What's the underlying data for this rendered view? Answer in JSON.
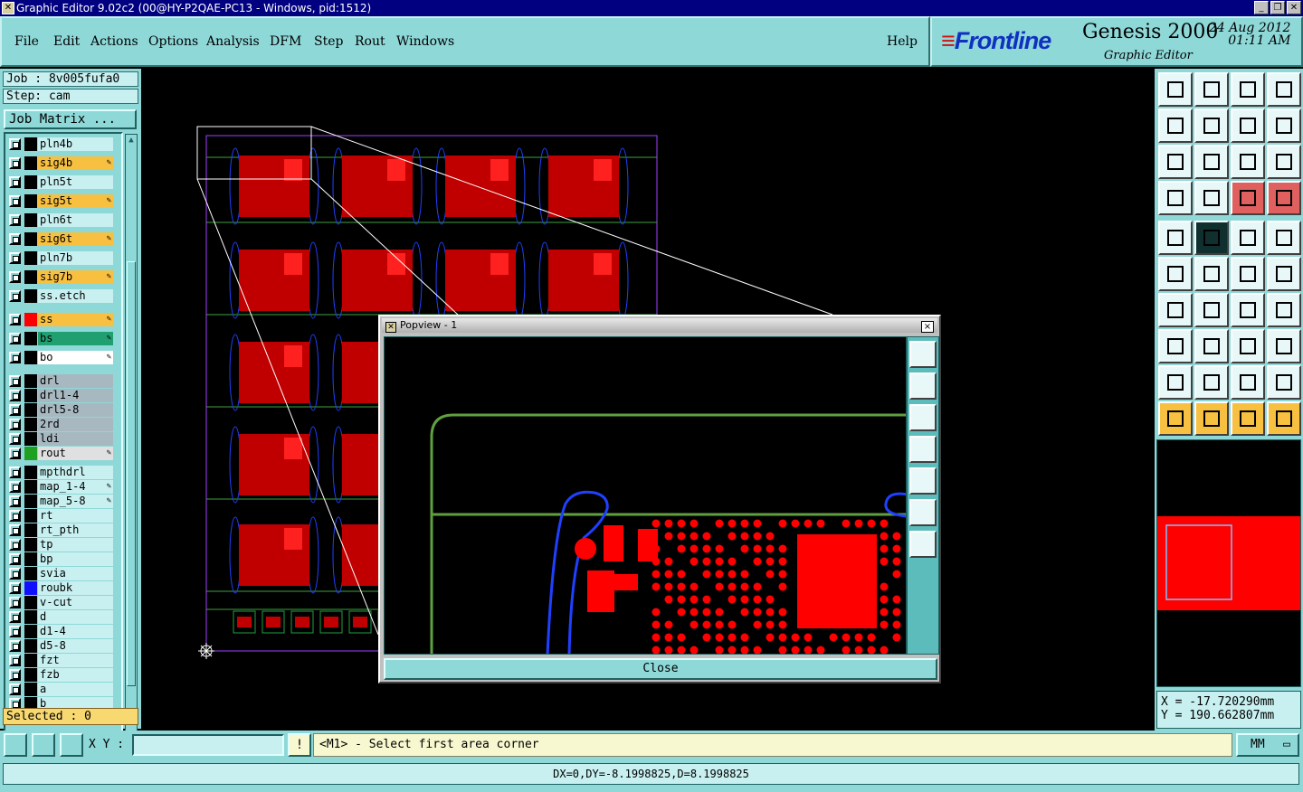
{
  "window": {
    "title": "Graphic Editor 9.02c2 (00@HY-P2QAE-PC13 - Windows, pid:1512)"
  },
  "menu": {
    "items": [
      "File",
      "Edit",
      "Actions",
      "Options",
      "Analysis",
      "DFM",
      "Step",
      "Rout",
      "Windows"
    ],
    "help": "Help"
  },
  "brand": {
    "logo": "Frontline",
    "product": "Genesis 2000",
    "subtitle": "Graphic Editor",
    "date": "24 Aug 2012",
    "time": "01:11 AM"
  },
  "job": {
    "job_label": "Job : 8v005fufa0",
    "step_label": "Step: cam",
    "matrix_button": "Job Matrix ..."
  },
  "layers": [
    {
      "name": "pln4b",
      "color": "#c8f0f0",
      "swatch": "#000000",
      "editable": false
    },
    {
      "name": "sig4b",
      "color": "#f8c040",
      "swatch": "#000000",
      "editable": true
    },
    {
      "name": "pln5t",
      "color": "#c8f0f0",
      "swatch": "#000000",
      "editable": false
    },
    {
      "name": "sig5t",
      "color": "#f8c040",
      "swatch": "#000000",
      "editable": true
    },
    {
      "name": "pln6t",
      "color": "#c8f0f0",
      "swatch": "#000000",
      "editable": false
    },
    {
      "name": "sig6t",
      "color": "#f8c040",
      "swatch": "#000000",
      "editable": true
    },
    {
      "name": "pln7b",
      "color": "#c8f0f0",
      "swatch": "#000000",
      "editable": false
    },
    {
      "name": "sig7b",
      "color": "#f8c040",
      "swatch": "#000000",
      "editable": true
    },
    {
      "name": "ss.etch",
      "color": "#c8f0f0",
      "swatch": "#000000",
      "editable": false
    },
    {
      "name": "ss",
      "color": "#f8c040",
      "swatch": "#ff0000",
      "editable": true
    },
    {
      "name": "bs",
      "color": "#20a070",
      "swatch": "#000000",
      "editable": true
    },
    {
      "name": "bo",
      "color": "#ffffff",
      "swatch": "#000000",
      "editable": true
    },
    {
      "name": "drl",
      "color": "#a8b8c0",
      "swatch": "#000000",
      "editable": false
    },
    {
      "name": "drl1-4",
      "color": "#a8b8c0",
      "swatch": "#000000",
      "editable": false
    },
    {
      "name": "drl5-8",
      "color": "#a8b8c0",
      "swatch": "#000000",
      "editable": false
    },
    {
      "name": "2rd",
      "color": "#a8b8c0",
      "swatch": "#000000",
      "editable": false
    },
    {
      "name": "ldi",
      "color": "#a8b8c0",
      "swatch": "#000000",
      "editable": false
    },
    {
      "name": "rout",
      "color": "#e0e0e0",
      "swatch": "#20a020",
      "editable": true
    },
    {
      "name": "mpthdrl",
      "color": "#c8f0f0",
      "swatch": "#000000",
      "editable": false
    },
    {
      "name": "map_1-4",
      "color": "#c8f0f0",
      "swatch": "#000000",
      "editable": true
    },
    {
      "name": "map_5-8",
      "color": "#c8f0f0",
      "swatch": "#000000",
      "editable": true
    },
    {
      "name": "rt",
      "color": "#c8f0f0",
      "swatch": "#000000",
      "editable": false
    },
    {
      "name": "rt_pth",
      "color": "#c8f0f0",
      "swatch": "#000000",
      "editable": false
    },
    {
      "name": "tp",
      "color": "#c8f0f0",
      "swatch": "#000000",
      "editable": false
    },
    {
      "name": "bp",
      "color": "#c8f0f0",
      "swatch": "#000000",
      "editable": false
    },
    {
      "name": "svia",
      "color": "#c8f0f0",
      "swatch": "#000000",
      "editable": false
    },
    {
      "name": "roubk",
      "color": "#c8f0f0",
      "swatch": "#1010ff",
      "editable": false
    },
    {
      "name": "v-cut",
      "color": "#c8f0f0",
      "swatch": "#000000",
      "editable": false
    },
    {
      "name": "d",
      "color": "#c8f0f0",
      "swatch": "#000000",
      "editable": false
    },
    {
      "name": "d1-4",
      "color": "#c8f0f0",
      "swatch": "#000000",
      "editable": false
    },
    {
      "name": "d5-8",
      "color": "#c8f0f0",
      "swatch": "#000000",
      "editable": false
    },
    {
      "name": "fzt",
      "color": "#c8f0f0",
      "swatch": "#000000",
      "editable": false
    },
    {
      "name": "fzb",
      "color": "#c8f0f0",
      "swatch": "#000000",
      "editable": false
    },
    {
      "name": "a",
      "color": "#c8f0f0",
      "swatch": "#000000",
      "editable": false
    },
    {
      "name": "b",
      "color": "#c8f0f0",
      "swatch": "#000000",
      "editable": false
    }
  ],
  "selected": "Selected : 0",
  "popview": {
    "title": "Popview - 1",
    "close_button": "Close",
    "close_icon": "×"
  },
  "coords": {
    "x": "X = -17.720290mm",
    "y": "Y = 190.662807mm"
  },
  "status": {
    "xy_label": "X Y :",
    "xy_value": "",
    "prompt": "<M1> - Select first area corner",
    "units": "MM",
    "measure": "DX=0,DY=-8.1998825,D=8.1998825",
    "info_icon": "!"
  }
}
